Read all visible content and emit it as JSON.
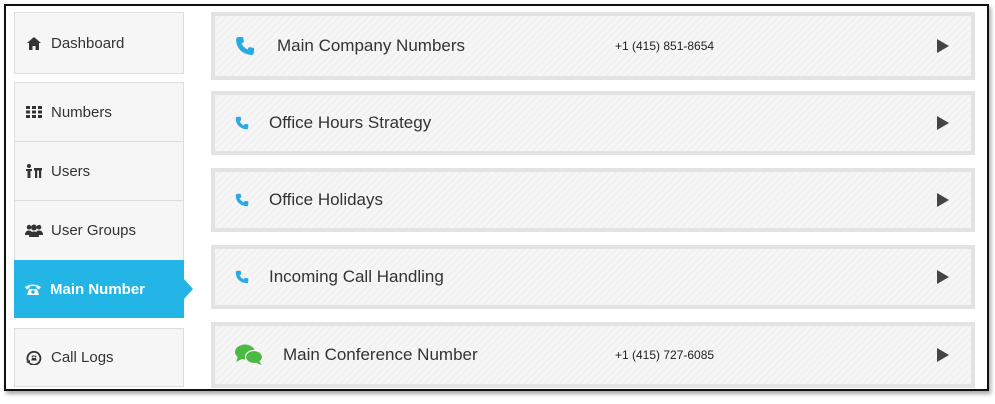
{
  "sidebar": {
    "items": [
      {
        "label": "Dashboard",
        "icon": "home-icon"
      },
      {
        "label": "Numbers",
        "icon": "grid-icon"
      },
      {
        "label": "Users",
        "icon": "users-icon"
      },
      {
        "label": "User Groups",
        "icon": "user-groups-icon"
      },
      {
        "label": "Main Number",
        "icon": "phone-icon",
        "active": true
      },
      {
        "label": "Call Logs",
        "icon": "call-logs-icon"
      }
    ]
  },
  "rows": [
    {
      "title": "Main Company Numbers",
      "phone": "+1 (415) 851-8654",
      "icon": "phone-icon"
    },
    {
      "title": "Office Hours Strategy",
      "phone": "",
      "icon": "phone-icon"
    },
    {
      "title": "Office Holidays",
      "phone": "",
      "icon": "phone-icon"
    },
    {
      "title": "Incoming Call Handling",
      "phone": "",
      "icon": "phone-icon"
    },
    {
      "title": "Main Conference Number",
      "phone": "+1 (415) 727-6085",
      "icon": "chat-bubbles-icon"
    }
  ],
  "colors": {
    "accent": "#22b5e6",
    "phone_icon": "#29abe2",
    "chat_icon": "#4cb944"
  }
}
